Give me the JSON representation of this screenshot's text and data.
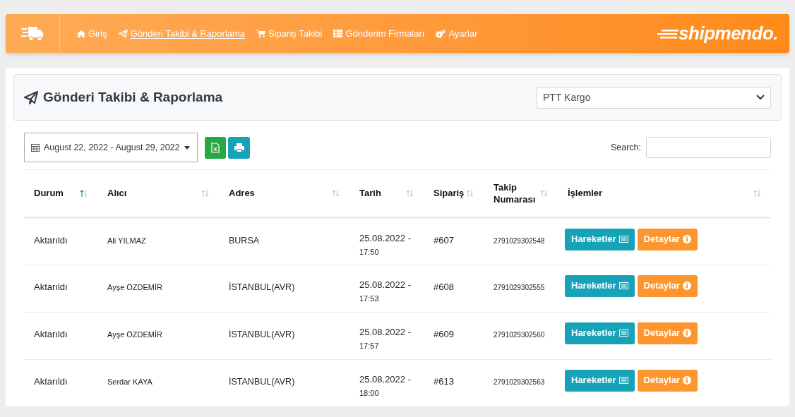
{
  "nav": {
    "items": [
      {
        "label": "Giriş",
        "selected": false
      },
      {
        "label": "Gönderi Takibi & Raporlama",
        "selected": true
      },
      {
        "label": "Sipariş Takibi",
        "selected": false
      },
      {
        "label": "Gönderim Firmaları",
        "selected": false
      },
      {
        "label": "Ayarlar",
        "selected": false
      }
    ],
    "logo": "shipmendo."
  },
  "page_title": "Gönderi Takibi & Raporlama",
  "carrier_select": {
    "value": "PTT Kargo"
  },
  "date_range": "August 22, 2022 - August 29, 2022",
  "search": {
    "label": "Search:"
  },
  "table": {
    "columns": [
      {
        "label": "Durum",
        "sorted": true
      },
      {
        "label": "Alıcı",
        "sorted": false
      },
      {
        "label": "Adres",
        "sorted": false
      },
      {
        "label": "Tarih",
        "sorted": false
      },
      {
        "label": "Sipariş",
        "sorted": false
      },
      {
        "label": "Takip Numarası",
        "sorted": false
      },
      {
        "label": "İşlemler",
        "sorted": false
      }
    ],
    "rows": [
      {
        "status": "Aktarıldı",
        "recipient": "Ali YILMAZ",
        "address": "BURSA",
        "date": "25.08.2022 -",
        "time": "17:50",
        "order": "#607",
        "tracking": "2791029302548",
        "actions": [
          "Hareketler",
          "Detaylar"
        ]
      },
      {
        "status": "Aktarıldı",
        "recipient": "Ayşe ÖZDEMİR",
        "address": "İSTANBUL(AVR)",
        "date": "25.08.2022 -",
        "time": "17:53",
        "order": "#608",
        "tracking": "2791029302555",
        "actions": [
          "Hareketler",
          "Detaylar"
        ]
      },
      {
        "status": "Aktarıldı",
        "recipient": "Ayşe ÖZDEMİR",
        "address": "İSTANBUL(AVR)",
        "date": "25.08.2022 -",
        "time": "17:57",
        "order": "#609",
        "tracking": "2791029302560",
        "actions": [
          "Hareketler",
          "Detaylar"
        ]
      },
      {
        "status": "Aktarıldı",
        "recipient": "Serdar KAYA",
        "address": "İSTANBUL(AVR)",
        "date": "25.08.2022 -",
        "time": "18:00",
        "order": "#613",
        "tracking": "2791029302563",
        "actions": [
          "Hareketler",
          "Detaylar"
        ]
      }
    ]
  }
}
